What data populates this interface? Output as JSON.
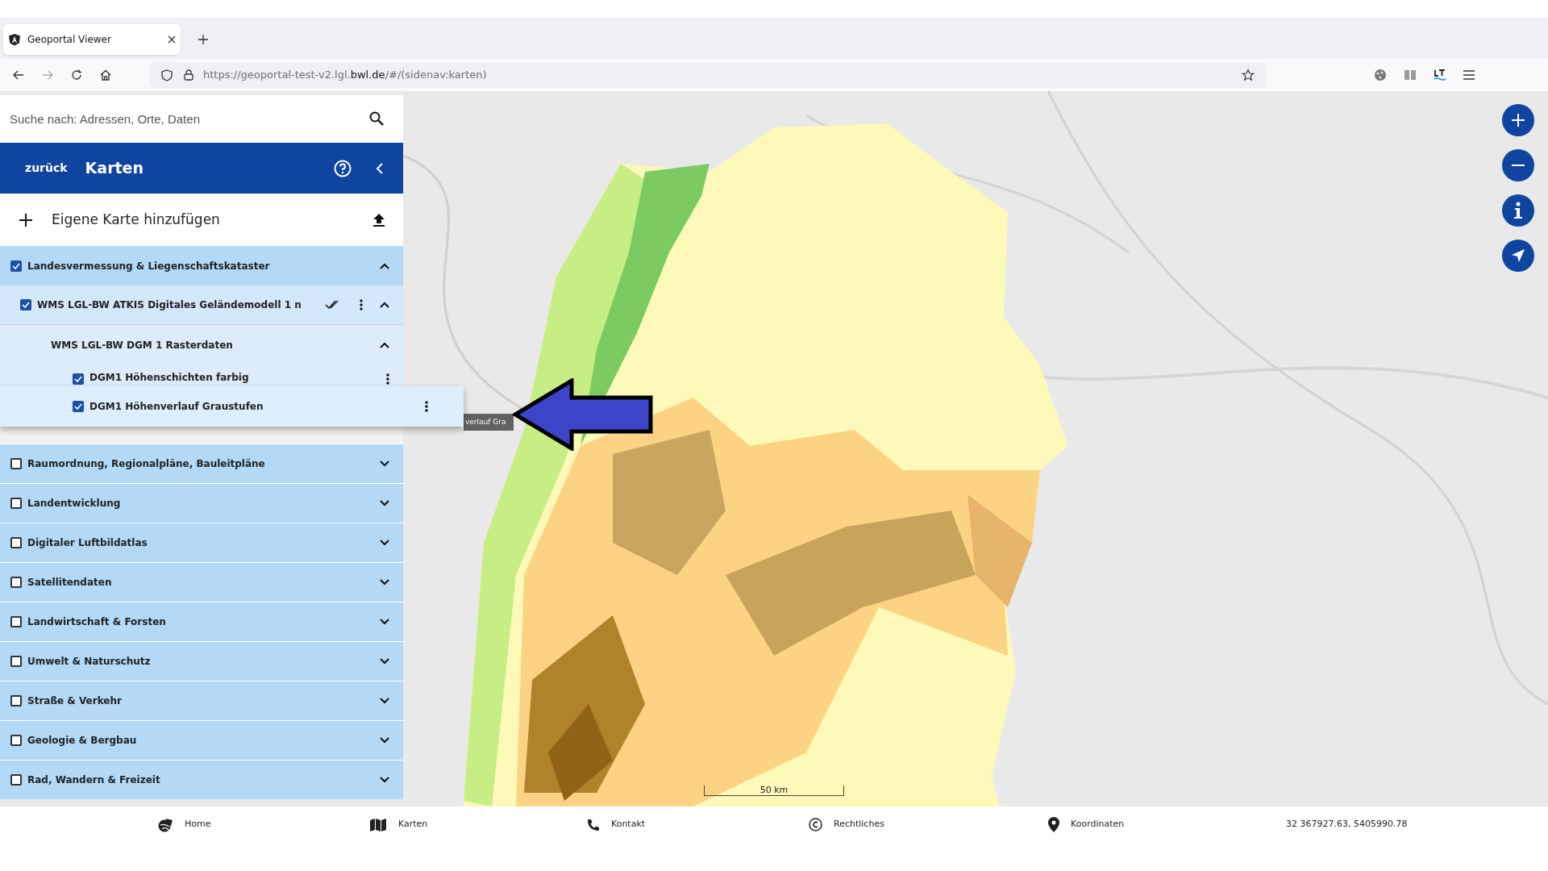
{
  "browser": {
    "tab": {
      "title": "Geoportal Viewer",
      "selected": true
    },
    "url": {
      "prefix": "https://geoportal-test-v2.lgl.",
      "domain": "bwl.de",
      "suffix": "/#/(sidenav:karten)"
    }
  },
  "search": {
    "placeholder": "Suche nach: Adressen, Orte, Daten"
  },
  "header": {
    "back": "zurück",
    "title": "Karten"
  },
  "add_map": {
    "label": "Eigene Karte hinzufügen"
  },
  "layers": [
    {
      "label": "Landesvermessung & Liegenschaftskataster",
      "checked": true,
      "expanded": true,
      "children": [
        {
          "label": "WMS LGL-BW ATKIS Digitales Geländemodell 1 n",
          "checked": true,
          "expanded": true,
          "children": [
            {
              "label": "WMS LGL-BW DGM 1 Rasterdaten",
              "expanded": true,
              "children": [
                {
                  "label": "DGM1 Höhenschichten farbig",
                  "checked": true,
                  "dragging": false
                },
                {
                  "label": "DGM1 Höhenverlauf Graustufen",
                  "checked": true,
                  "dragging": true
                }
              ]
            }
          ]
        }
      ]
    },
    {
      "label": "Raumordnung, Regionalpläne, Bauleitpläne",
      "checked": false,
      "expanded": false
    },
    {
      "label": "Landentwicklung",
      "checked": false,
      "expanded": false
    },
    {
      "label": "Digitaler Luftbildatlas",
      "checked": false,
      "expanded": false
    },
    {
      "label": "Satellitendaten",
      "checked": false,
      "expanded": false
    },
    {
      "label": "Landwirtschaft & Forsten",
      "checked": false,
      "expanded": false
    },
    {
      "label": "Umwelt & Naturschutz",
      "checked": false,
      "expanded": false
    },
    {
      "label": "Straße & Verkehr",
      "checked": false,
      "expanded": false
    },
    {
      "label": "Geologie & Bergbau",
      "checked": false,
      "expanded": false
    },
    {
      "label": "Rad, Wandern & Freizeit",
      "checked": false,
      "expanded": false
    }
  ],
  "tooltip": {
    "text": "verlauf Gra"
  },
  "map": {
    "scale": "50 km"
  },
  "footer": {
    "items": [
      {
        "kind": "home",
        "label": "Home"
      },
      {
        "kind": "maps",
        "label": "Karten"
      },
      {
        "kind": "contact",
        "label": "Kontakt"
      },
      {
        "kind": "legal",
        "label": "Rechtliches"
      },
      {
        "kind": "coords",
        "label": "Koordinaten"
      }
    ],
    "coordinates": "32 367927.63, 5405990.78"
  }
}
